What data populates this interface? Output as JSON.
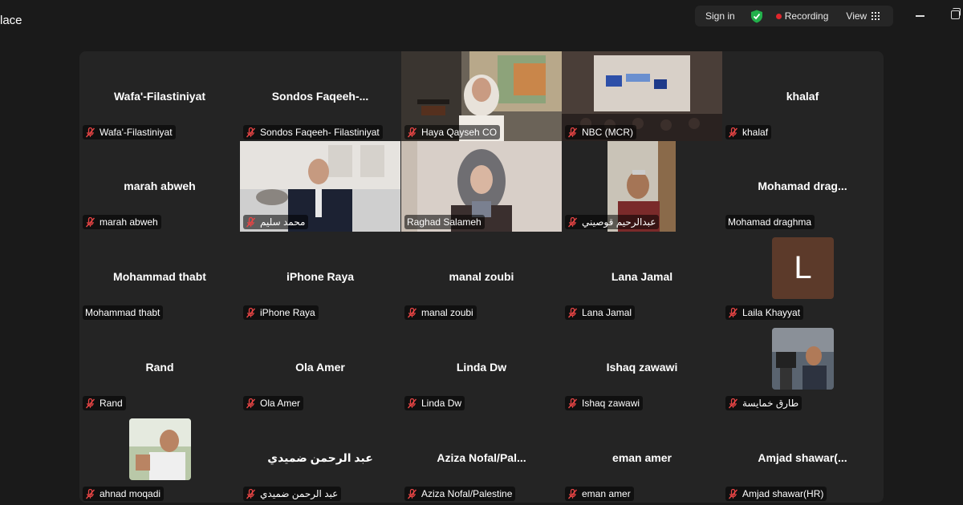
{
  "app": {
    "title": "lace"
  },
  "top_controls": {
    "sign_in": "Sign in",
    "recording": "Recording",
    "view": "View"
  },
  "colors": {
    "active_speaker": "#5ed078",
    "recording_dot": "#e0262c",
    "avatar_bg": "#5c3a2a"
  },
  "participants": [
    {
      "big_name": "Wafa'-Filastiniyat",
      "label": "Wafa'-Filastiniyat",
      "muted": true
    },
    {
      "big_name": "Sondos Faqeeh-...",
      "label": "Sondos Faqeeh- Filastiniyat",
      "muted": true
    },
    {
      "big_name": "",
      "label": "Haya Qayseh CO",
      "muted": true,
      "video": true
    },
    {
      "big_name": "",
      "label": "NBC (MCR)",
      "muted": true,
      "video": true
    },
    {
      "big_name": "khalaf",
      "label": "khalaf",
      "muted": true
    },
    {
      "big_name": "marah abweh",
      "label": "marah abweh",
      "muted": true
    },
    {
      "big_name": "",
      "label": "محمد سليم",
      "muted": true,
      "video": true
    },
    {
      "big_name": "",
      "label": "Raghad Salameh",
      "muted": false,
      "video": true,
      "active": true
    },
    {
      "big_name": "",
      "label": "عبدالرحيم قوصيني",
      "muted": true,
      "video": true
    },
    {
      "big_name": "Mohamad drag...",
      "label": "Mohamad draghma",
      "muted": false
    },
    {
      "big_name": "Mohammad thabt",
      "label": "Mohammad thabt",
      "muted": false
    },
    {
      "big_name": "iPhone Raya",
      "label": "iPhone Raya",
      "muted": true
    },
    {
      "big_name": "manal zoubi",
      "label": "manal zoubi",
      "muted": true
    },
    {
      "big_name": "Lana Jamal",
      "label": "Lana Jamal",
      "muted": true
    },
    {
      "big_name": "",
      "label": "Laila Khayyat",
      "muted": true,
      "avatar_letter": "L"
    },
    {
      "big_name": "Rand",
      "label": "Rand",
      "muted": true
    },
    {
      "big_name": "Ola Amer",
      "label": "Ola Amer",
      "muted": true
    },
    {
      "big_name": "Linda Dw",
      "label": "Linda Dw",
      "muted": true
    },
    {
      "big_name": "Ishaq zawawi",
      "label": "Ishaq zawawi",
      "muted": true
    },
    {
      "big_name": "",
      "label": "طارق خمايسة",
      "muted": true,
      "photo": true
    },
    {
      "big_name": "",
      "label": "ahnad moqadi",
      "muted": true,
      "photo": true
    },
    {
      "big_name": "عبد الرحمن ضميدي",
      "label": "عبد الرحمن ضميدي",
      "muted": true
    },
    {
      "big_name": "Aziza Nofal/Pal...",
      "label": "Aziza Nofal/Palestine",
      "muted": true
    },
    {
      "big_name": "eman amer",
      "label": "eman amer",
      "muted": true
    },
    {
      "big_name": "Amjad shawar(...",
      "label": "Amjad shawar(HR)",
      "muted": true
    }
  ]
}
